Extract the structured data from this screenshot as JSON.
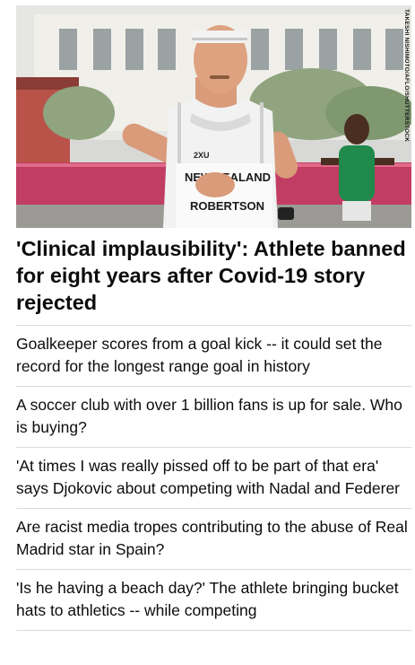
{
  "hero": {
    "image_alt": "Marathon runner in a New Zealand vest",
    "credit": "Takeshi Nishimoto/AFLO/Shutterstock",
    "bib_line1": "NEW ZEALAND",
    "bib_line2": "ROBERTSON",
    "brand": "2XU"
  },
  "headline": "'Clinical implausibility': Athlete banned for eight years after Covid-19 story rejected",
  "stories": [
    {
      "text": "Goalkeeper scores from a goal kick -- it could set the record for the longest range goal in history"
    },
    {
      "text": "A soccer club with over 1 billion fans is up for sale. Who is buying?"
    },
    {
      "text": "'At times I was really pissed off to be part of that era' says Djokovic about competing with Nadal and Federer"
    },
    {
      "text": "Are racist media tropes contributing to the abuse of Real Madrid star in Spain?"
    },
    {
      "text": "'Is he having a beach day?' The athlete bringing bucket hats to athletics -- while competing"
    }
  ]
}
